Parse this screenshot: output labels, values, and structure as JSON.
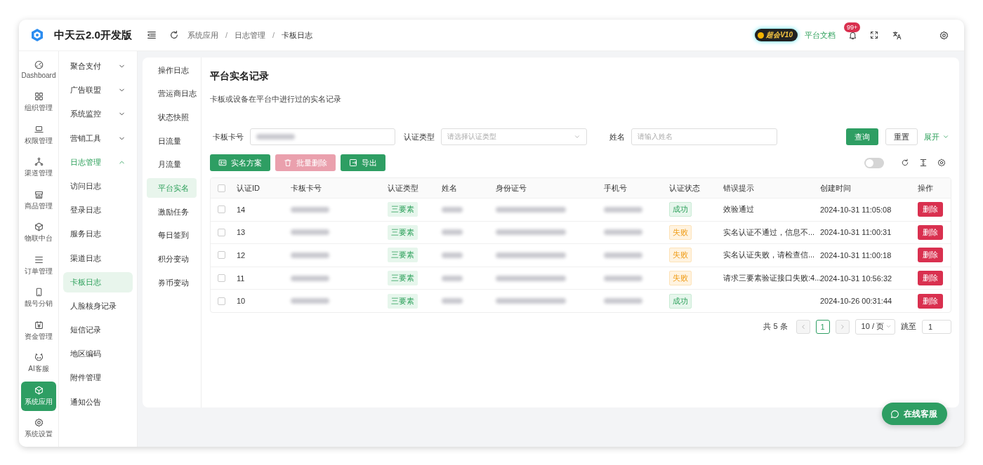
{
  "app": {
    "name": "中天云2.0开发版"
  },
  "topbar": {
    "breadcrumb": [
      {
        "text": "系统应用",
        "kind": "link"
      },
      {
        "text": "/",
        "kind": "separator"
      },
      {
        "text": "日志管理",
        "kind": "link"
      },
      {
        "text": "/",
        "kind": "separator"
      },
      {
        "text": "卡板日志",
        "kind": "current"
      }
    ],
    "vip_badge": "超会V10",
    "docs_link": "平台文档",
    "notification_count": "99+"
  },
  "rail": [
    {
      "label": "Dashboard",
      "selected": false
    },
    {
      "label": "组织管理",
      "selected": false
    },
    {
      "label": "权限管理",
      "selected": false
    },
    {
      "label": "渠道管理",
      "selected": false
    },
    {
      "label": "商品管理",
      "selected": false
    },
    {
      "label": "物联中台",
      "selected": false
    },
    {
      "label": "订单管理",
      "selected": false
    },
    {
      "label": "靓号分销",
      "selected": false
    },
    {
      "label": "资金管理",
      "selected": false
    },
    {
      "label": "AI客服",
      "selected": false
    },
    {
      "label": "系统应用",
      "selected": true
    },
    {
      "label": "系统设置",
      "selected": false
    }
  ],
  "menu": [
    {
      "label": "聚合支付",
      "expanded": false
    },
    {
      "label": "广告联盟",
      "expanded": false
    },
    {
      "label": "系统监控",
      "expanded": false
    },
    {
      "label": "营销工具",
      "expanded": false
    },
    {
      "label": "日志管理",
      "expanded": true,
      "children": [
        {
          "label": "访问日志",
          "selected": false
        },
        {
          "label": "登录日志",
          "selected": false
        },
        {
          "label": "服务日志",
          "selected": false
        },
        {
          "label": "渠道日志",
          "selected": false
        },
        {
          "label": "卡板日志",
          "selected": true
        },
        {
          "label": "人脸核身记录",
          "selected": false
        },
        {
          "label": "短信记录",
          "selected": false
        },
        {
          "label": "地区编码",
          "selected": false
        },
        {
          "label": "附件管理",
          "selected": false
        },
        {
          "label": "通知公告",
          "selected": false
        }
      ]
    }
  ],
  "subnav": [
    {
      "label": "操作日志",
      "selected": false
    },
    {
      "label": "营运商日志",
      "selected": false
    },
    {
      "label": "状态快照",
      "selected": false
    },
    {
      "label": "日流量",
      "selected": false
    },
    {
      "label": "月流量",
      "selected": false
    },
    {
      "label": "平台实名",
      "selected": true
    },
    {
      "label": "激励任务",
      "selected": false
    },
    {
      "label": "每日签到",
      "selected": false
    },
    {
      "label": "积分变动",
      "selected": false
    },
    {
      "label": "券币变动",
      "selected": false
    }
  ],
  "page": {
    "title": "平台实名记录",
    "description": "卡板或设备在平台中进行过的实名记录"
  },
  "filters": [
    {
      "label": "卡板卡号",
      "kind": "input",
      "redacted": true
    },
    {
      "label": "认证类型",
      "kind": "select",
      "placeholder": "请选择认证类型"
    },
    {
      "label": "姓名",
      "kind": "input",
      "placeholder": "请输入姓名"
    }
  ],
  "filter_actions": {
    "search": "查询",
    "reset": "重置",
    "expand": "展开"
  },
  "toolbar": [
    {
      "label": "实名方案",
      "disabled": false
    },
    {
      "label": "批量删除",
      "disabled": true
    },
    {
      "label": "导出",
      "disabled": false
    }
  ],
  "toolbar_toggle": {
    "on": false
  },
  "table": {
    "select_all": {
      "checked": false
    },
    "columns": [
      {
        "label": "认证ID"
      },
      {
        "label": "卡板卡号",
        "redacted": true
      },
      {
        "label": "认证类型"
      },
      {
        "label": "姓名",
        "redacted": true
      },
      {
        "label": "身份证号",
        "redacted": true
      },
      {
        "label": "手机号",
        "redacted": true
      },
      {
        "label": "认证状态"
      },
      {
        "label": "错误提示"
      },
      {
        "label": "创建时间"
      },
      {
        "label": "操作"
      }
    ],
    "rows": [
      {
        "checked": false,
        "id": "14",
        "auth_type": "三要素",
        "status": {
          "text": "成功",
          "kind": "success"
        },
        "error": "效验通过",
        "created": "2024-10-31 11:05:08",
        "action": "删除"
      },
      {
        "checked": false,
        "id": "13",
        "auth_type": "三要素",
        "status": {
          "text": "失败",
          "kind": "fail"
        },
        "error": "实名认证不通过，信息不...",
        "created": "2024-10-31 11:00:31",
        "action": "删除"
      },
      {
        "checked": false,
        "id": "12",
        "auth_type": "三要素",
        "status": {
          "text": "失败",
          "kind": "fail"
        },
        "error": "实名认证失败，请检查信...",
        "created": "2024-10-31 11:00:18",
        "action": "删除"
      },
      {
        "checked": false,
        "id": "11",
        "auth_type": "三要素",
        "status": {
          "text": "失败",
          "kind": "fail"
        },
        "error": "请求三要素验证接口失败:4...",
        "created": "2024-10-31 10:56:32",
        "action": "删除"
      },
      {
        "checked": false,
        "id": "10",
        "auth_type": "三要素",
        "status": {
          "text": "成功",
          "kind": "success"
        },
        "created": "2024-10-26 00:31:44",
        "action": "删除"
      }
    ]
  },
  "pagination": {
    "total": "共 5 条",
    "pages": [
      {
        "label": "1",
        "selected": true
      }
    ],
    "page_size": "10 / 页",
    "jump_label": "跳至",
    "jump_value": "1"
  },
  "chat_button": "在线客服"
}
